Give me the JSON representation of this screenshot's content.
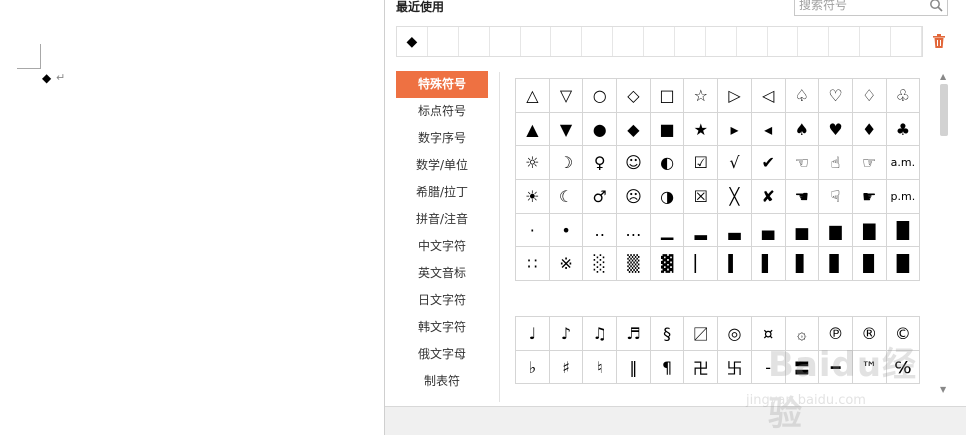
{
  "document": {
    "cursor_symbol": "◆",
    "paragraph_mark": "↵"
  },
  "panel": {
    "recent_title": "最近使用",
    "search_placeholder": "搜索符号",
    "recent": [
      "◆",
      "",
      "",
      "",
      "",
      "",
      "",
      "",
      "",
      "",
      "",
      "",
      "",
      "",
      "",
      "",
      ""
    ],
    "categories": [
      {
        "label": "特殊符号",
        "active": true
      },
      {
        "label": "标点符号",
        "active": false
      },
      {
        "label": "数字序号",
        "active": false
      },
      {
        "label": "数学/单位",
        "active": false
      },
      {
        "label": "希腊/拉丁",
        "active": false
      },
      {
        "label": "拼音/注音",
        "active": false
      },
      {
        "label": "中文字符",
        "active": false
      },
      {
        "label": "英文音标",
        "active": false
      },
      {
        "label": "日文字符",
        "active": false
      },
      {
        "label": "韩文字符",
        "active": false
      },
      {
        "label": "俄文字母",
        "active": false
      },
      {
        "label": "制表符",
        "active": false
      }
    ],
    "grid1": [
      [
        "△",
        "▽",
        "○",
        "◇",
        "□",
        "☆",
        "▷",
        "◁",
        "♤",
        "♡",
        "♢",
        "♧"
      ],
      [
        "▲",
        "▼",
        "●",
        "◆",
        "■",
        "★",
        "▸",
        "◂",
        "♠",
        "♥",
        "♦",
        "♣"
      ],
      [
        "☼",
        "☽",
        "♀",
        "☺",
        "◐",
        "☑",
        "√",
        "✔",
        "☜",
        "☝",
        "☞",
        "a.m."
      ],
      [
        "☀",
        "☾",
        "♂",
        "☹",
        "◑",
        "☒",
        "╳",
        "✘",
        "☚",
        "☟",
        "☛",
        "p.m."
      ],
      [
        "·",
        "•",
        "‥",
        "…",
        "▁",
        "▂",
        "▃",
        "▄",
        "▅",
        "▆",
        "▇",
        "█"
      ],
      [
        "∷",
        "※",
        "░",
        "▒",
        "▓",
        "▏",
        "▍",
        "▌",
        "▋",
        "▊",
        "▉",
        "█"
      ]
    ],
    "grid2": [
      [
        "♩",
        "♪",
        "♫",
        "♬",
        "§",
        "〼",
        "◎",
        "¤",
        "۞",
        "℗",
        "®",
        "©"
      ],
      [
        "♭",
        "♯",
        "♮",
        "‖",
        "¶",
        "卍",
        "卐",
        "‐",
        "〓",
        "━",
        "™",
        "℅"
      ]
    ]
  },
  "watermark": {
    "text": "Baidu经验",
    "url": "jingyan.baidu.com"
  }
}
